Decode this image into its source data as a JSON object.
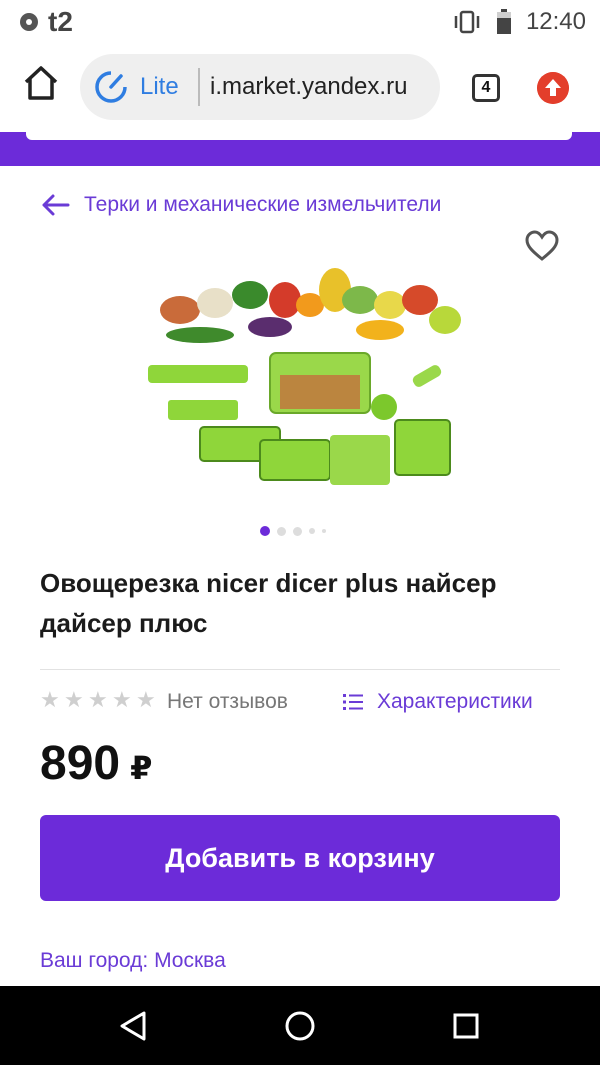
{
  "status_bar": {
    "carrier": "t2",
    "time": "12:40"
  },
  "browser": {
    "mode_label": "Lite",
    "url": "i.market.yandex.ru",
    "tabs_count": "4"
  },
  "breadcrumb": {
    "label": "Терки и механические измельчители"
  },
  "gallery": {
    "active_index": 0,
    "dots_count": 5
  },
  "product": {
    "title": "Овощерезка nicer dicer plus найсер дайсер плюс",
    "rating_stars": 0,
    "reviews_label": "Нет отзывов",
    "specs_label": "Характеристики",
    "price": "890",
    "currency": "₽",
    "add_to_cart_label": "Добавить в корзину"
  },
  "footer": {
    "city_label": "Ваш город: Москва"
  },
  "colors": {
    "accent": "#6c2bd9",
    "link": "#6a3bd6",
    "browser_accent": "#2f7de1",
    "update_badge": "#e33e2b"
  },
  "icons": [
    "home-icon",
    "lite-speed-icon",
    "tabs-icon",
    "update-arrow-icon",
    "back-arrow-icon",
    "heart-icon",
    "star-icon",
    "list-icon",
    "nav-back-icon",
    "nav-home-icon",
    "nav-recents-icon"
  ]
}
